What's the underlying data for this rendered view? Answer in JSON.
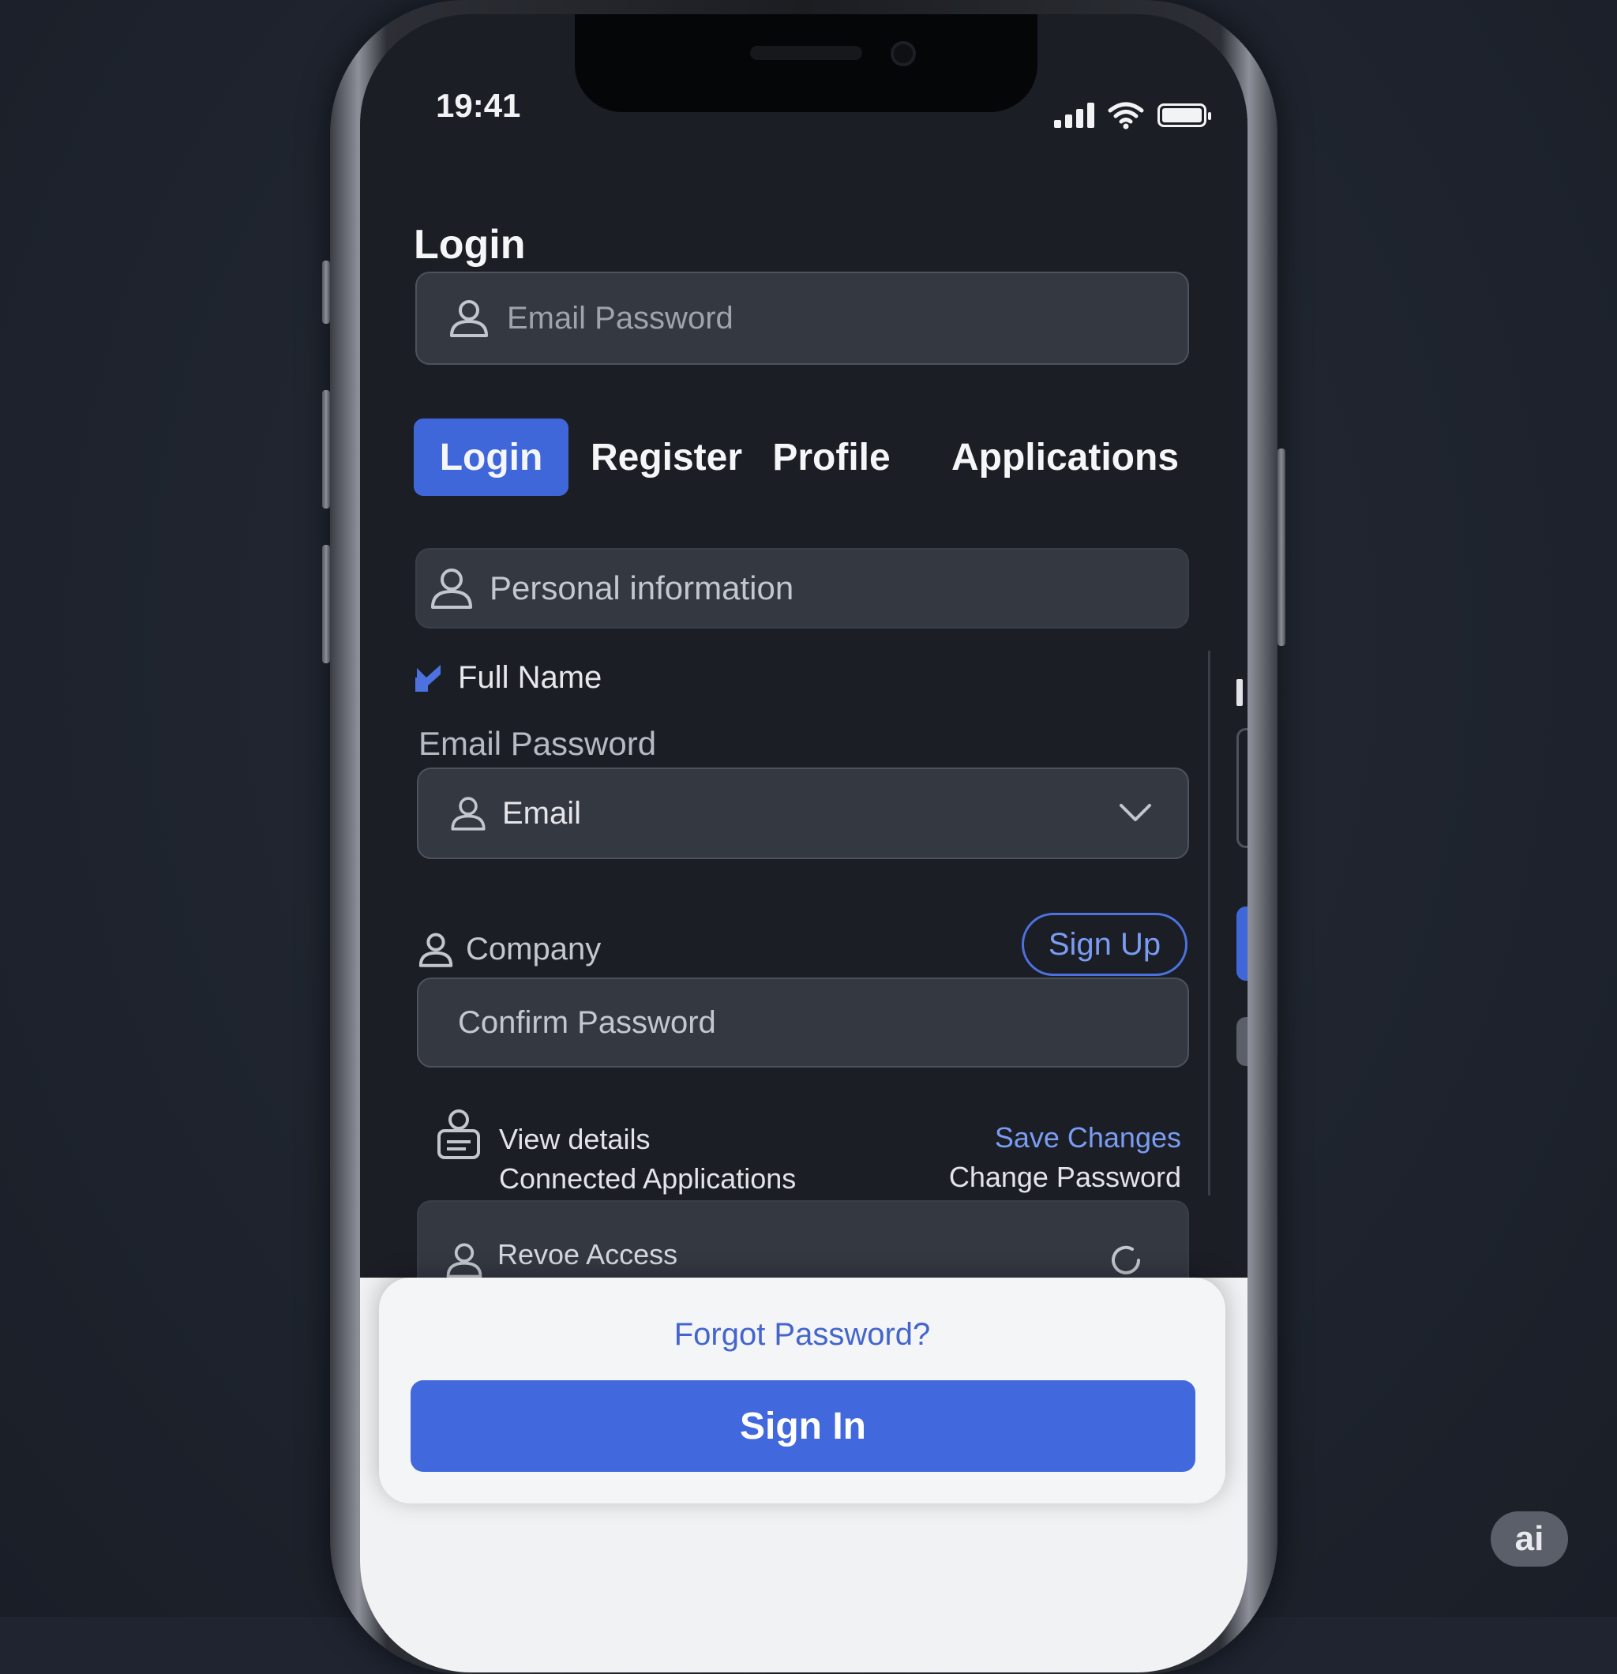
{
  "status": {
    "time": "19:41"
  },
  "page": {
    "title": "Login"
  },
  "top_field": {
    "placeholder": "Email Password"
  },
  "tabs": [
    {
      "label": "Login",
      "active": true
    },
    {
      "label": "Register",
      "active": false
    },
    {
      "label": "Profile",
      "active": false
    },
    {
      "label": "Applications",
      "active": false
    }
  ],
  "personal": {
    "header": "Personal information"
  },
  "full_name": {
    "label": "Full Name"
  },
  "email_password_label": "Email Password",
  "email_select": {
    "value": "Email"
  },
  "company": {
    "label": "Company"
  },
  "signup": {
    "label": "Sign Up"
  },
  "confirm_password": {
    "placeholder": "Confirm Password"
  },
  "details": {
    "view": "View details",
    "connected": "Connected Applications",
    "save": "Save Changes",
    "change_password": "Change Password"
  },
  "revoke": {
    "label": "Revoe Access"
  },
  "sheet": {
    "forgot": "Forgot Password?",
    "signin": "Sign In"
  },
  "badge": {
    "label": "ai"
  },
  "colors": {
    "accent": "#3f67d9",
    "background": "#1b1e25",
    "field": "#343841",
    "link": "#4466cc"
  },
  "icons": [
    "user-icon",
    "checkmark-icon",
    "chevron-down-icon",
    "id-card-icon",
    "refresh-icon",
    "wifi-icon",
    "battery-icon",
    "signal-icon"
  ]
}
